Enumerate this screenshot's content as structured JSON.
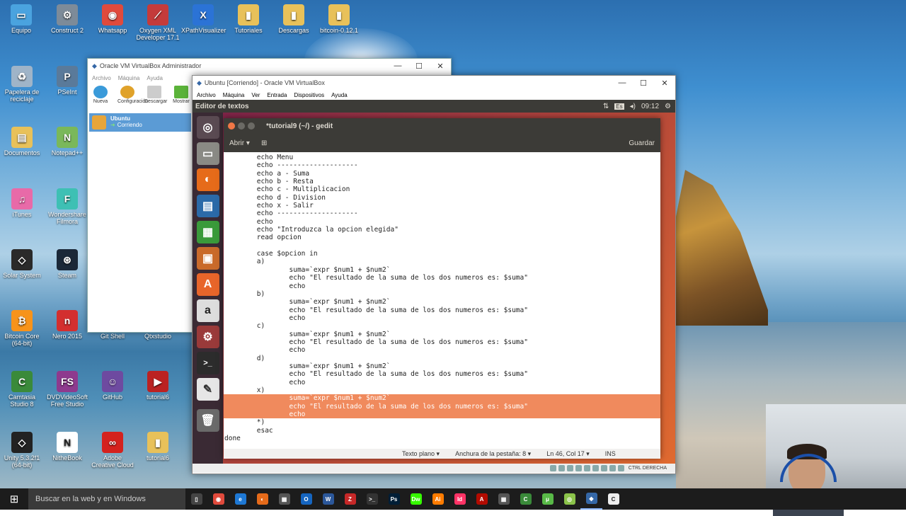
{
  "desktop_icons": [
    {
      "label": "Equipo",
      "icon": "computer-icon",
      "color": "#4aa3df",
      "glyph": "▭"
    },
    {
      "label": "Construct 2",
      "icon": "gear-icon",
      "color": "#7d8b99",
      "glyph": "⚙"
    },
    {
      "label": "Whatsapp",
      "icon": "chrome-icon",
      "color": "#e04a3c",
      "glyph": "◉"
    },
    {
      "label": "Oxygen XML Developer 17.1",
      "icon": "oxygen-icon",
      "color": "#c43b3b",
      "glyph": "⟋"
    },
    {
      "label": "XPathVisualizer",
      "icon": "xpath-icon",
      "color": "#2b73d6",
      "glyph": "X"
    },
    {
      "label": "Tutoriales",
      "icon": "folder-icon",
      "color": "#e8c15a",
      "glyph": "▮"
    },
    {
      "label": "Descargas",
      "icon": "folder-icon",
      "color": "#e8c15a",
      "glyph": "▮"
    },
    {
      "label": "bitcoin-0.12.1",
      "icon": "folder-icon",
      "color": "#e8c15a",
      "glyph": "▮"
    },
    {
      "label": "Papelera de reciclaje",
      "icon": "recycle-bin-icon",
      "color": "#9fb4c8",
      "glyph": "♻"
    },
    {
      "label": "PSeInt",
      "icon": "pseint-icon",
      "color": "#5a7a9a",
      "glyph": "P"
    },
    {
      "label": "Documentos",
      "icon": "documents-icon",
      "color": "#e8c15a",
      "glyph": "▤"
    },
    {
      "label": "Notepad++",
      "icon": "notepad-icon",
      "color": "#7ab85a",
      "glyph": "N"
    },
    {
      "label": "iTunes",
      "icon": "itunes-icon",
      "color": "#e86aa8",
      "glyph": "♫"
    },
    {
      "label": "Wondershare Filmora",
      "icon": "filmora-icon",
      "color": "#3ec0b4",
      "glyph": "F"
    },
    {
      "label": "Solar System",
      "icon": "unity-icon",
      "color": "#2a2a2a",
      "glyph": "◇"
    },
    {
      "label": "Steam",
      "icon": "steam-icon",
      "color": "#1b2838",
      "glyph": "⊛"
    },
    {
      "label": "Bitcoin Core (64-bit)",
      "icon": "bitcoin-icon",
      "color": "#f7931a",
      "glyph": "₿"
    },
    {
      "label": "Nero 2015",
      "icon": "nero-icon",
      "color": "#d32f2f",
      "glyph": "n"
    },
    {
      "label": "Git Shell",
      "icon": "git-shell-icon",
      "color": "#555",
      "glyph": "$"
    },
    {
      "label": "Qtxstudio",
      "icon": "qt-icon",
      "color": "#5ab04a",
      "glyph": "Q"
    },
    {
      "label": "Camtasia Studio 8",
      "icon": "camtasia-icon",
      "color": "#3a8a3a",
      "glyph": "C"
    },
    {
      "label": "DVDVideoSoft Free Studio",
      "icon": "dvdvideosoft-icon",
      "color": "#8e3a8e",
      "glyph": "FS"
    },
    {
      "label": "GitHub",
      "icon": "github-icon",
      "color": "#6e4aa0",
      "glyph": "☺"
    },
    {
      "label": "tutorial6",
      "icon": "video-icon",
      "color": "#b22",
      "glyph": "▶"
    },
    {
      "label": "Unity 5.3.2f1 (64-bit)",
      "icon": "unity-icon",
      "color": "#222",
      "glyph": "◇"
    },
    {
      "label": "NitheBook",
      "icon": "nithebook-icon",
      "color": "#fff",
      "glyph": "N"
    },
    {
      "label": "Adobe Creative Cloud",
      "icon": "adobe-cc-icon",
      "color": "#d4221e",
      "glyph": "∞"
    },
    {
      "label": "tutorial6",
      "icon": "file-icon",
      "color": "#e8c15a",
      "glyph": "▮"
    }
  ],
  "vbox_manager": {
    "title": "Oracle VM VirtualBox Administrador",
    "menu": [
      "Archivo",
      "Máquina",
      "Ayuda"
    ],
    "toolbar": [
      "Nueva",
      "Configuración",
      "Descargar",
      "Mostrar"
    ],
    "vm": {
      "name": "Ubuntu",
      "state": "Corriendo"
    }
  },
  "vbox_window": {
    "title": "Ubuntu [Corriendo] - Oracle VM VirtualBox",
    "menu": [
      "Archivo",
      "Máquina",
      "Ver",
      "Entrada",
      "Dispositivos",
      "Ayuda"
    ],
    "host_key": "CTRL DERECHA"
  },
  "ubuntu": {
    "panel_title": "Editor de textos",
    "lang": "Es",
    "time": "09:12"
  },
  "gedit": {
    "title": "*tutorial9 (~/) - gedit",
    "open_label": "Abrir",
    "save_label": "Guardar",
    "lines": [
      "        echo Menu",
      "        echo --------------------",
      "        echo a - Suma",
      "        echo b - Resta",
      "        echo c - Multiplicacion",
      "        echo d - Division",
      "        echo x - Salir",
      "        echo --------------------",
      "        echo",
      "        echo \"Introduzca la opcion elegida\"",
      "        read opcion",
      "",
      "        case $opcion in",
      "        a)",
      "                suma=`expr $num1 + $num2`",
      "                echo \"El resultado de la suma de los dos numeros es: $suma\"",
      "                echo",
      "        b)",
      "                suma=`expr $num1 + $num2`",
      "                echo \"El resultado de la suma de los dos numeros es: $suma\"",
      "                echo",
      "        c)",
      "                suma=`expr $num1 + $num2`",
      "                echo \"El resultado de la suma de los dos numeros es: $suma\"",
      "                echo",
      "        d)",
      "                suma=`expr $num1 + $num2`",
      "                echo \"El resultado de la suma de los dos numeros es: $suma\"",
      "                echo",
      "        x)",
      "                suma=`expr $num1 + $num2`",
      "                echo \"El resultado de la suma de los dos numeros es: $suma\"",
      "                echo",
      "        *)",
      "        esac",
      "done"
    ],
    "selected_lines": [
      30,
      31,
      32
    ],
    "status": {
      "syntax": "Texto plano",
      "tab_width": "Anchura de la pestaña: 8",
      "position": "Ln 46, Col 17",
      "mode": "INS"
    }
  },
  "taskbar": {
    "search_placeholder": "Buscar en la web y en Windows",
    "apps": [
      {
        "icon": "task-view-icon",
        "color": "#444",
        "glyph": "▯"
      },
      {
        "icon": "chrome-icon",
        "color": "#e04a3c",
        "glyph": "◉"
      },
      {
        "icon": "edge-icon",
        "color": "#1e78d4",
        "glyph": "e"
      },
      {
        "icon": "firefox-icon",
        "color": "#e66b1a",
        "glyph": "◐"
      },
      {
        "icon": "store-icon",
        "color": "#555",
        "glyph": "▦"
      },
      {
        "icon": "outlook-icon",
        "color": "#1565c0",
        "glyph": "O"
      },
      {
        "icon": "word-icon",
        "color": "#2b579a",
        "glyph": "W"
      },
      {
        "icon": "filezilla-icon",
        "color": "#c62828",
        "glyph": "Z"
      },
      {
        "icon": "terminal-icon",
        "color": "#333",
        "glyph": ">_"
      },
      {
        "icon": "photoshop-icon",
        "color": "#001e36",
        "glyph": "Ps"
      },
      {
        "icon": "dreamweaver-icon",
        "color": "#35fa00",
        "glyph": "Dw"
      },
      {
        "icon": "illustrator-icon",
        "color": "#ff7c00",
        "glyph": "Ai"
      },
      {
        "icon": "indesign-icon",
        "color": "#ff3366",
        "glyph": "Id"
      },
      {
        "icon": "acrobat-icon",
        "color": "#b30b00",
        "glyph": "A"
      },
      {
        "icon": "calculator-icon",
        "color": "#555",
        "glyph": "▦"
      },
      {
        "icon": "camtasia-icon",
        "color": "#3a8a3a",
        "glyph": "C"
      },
      {
        "icon": "utorrent-icon",
        "color": "#58b947",
        "glyph": "μ"
      },
      {
        "icon": "android-icon",
        "color": "#8bc34a",
        "glyph": "◎"
      },
      {
        "icon": "virtualbox-icon",
        "color": "#3567a6",
        "glyph": "◆"
      },
      {
        "icon": "camtasia-recorder-icon",
        "color": "#eee",
        "glyph": "C"
      }
    ]
  }
}
